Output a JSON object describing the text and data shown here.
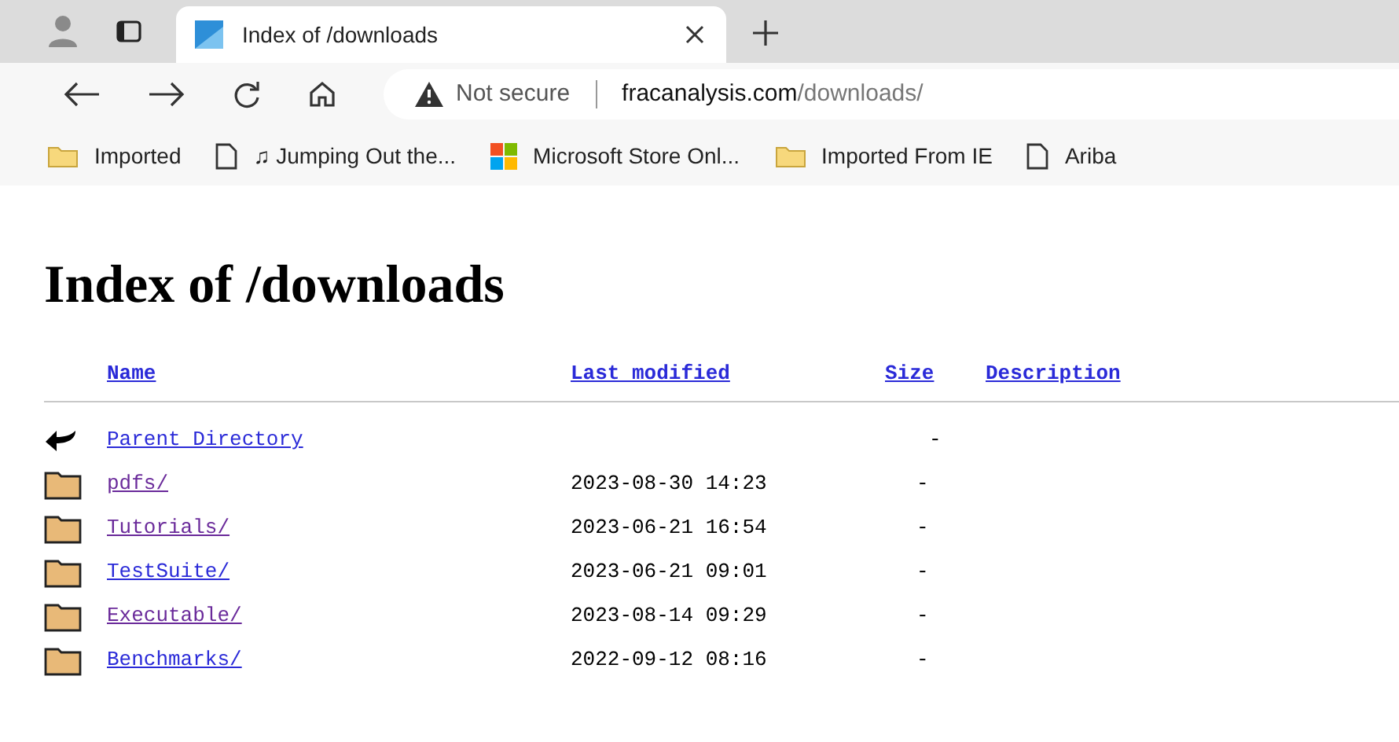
{
  "tab": {
    "title": "Index of /downloads",
    "selected": true
  },
  "address": {
    "warning": "Not secure",
    "host": "fracanalysis.com",
    "path": "/downloads/"
  },
  "bookmarks": [
    {
      "kind": "folder",
      "label": "Imported"
    },
    {
      "kind": "page",
      "label": "♫ Jumping Out the..."
    },
    {
      "kind": "store",
      "label": "Microsoft Store Onl..."
    },
    {
      "kind": "folder",
      "label": "Imported From IE"
    },
    {
      "kind": "page",
      "label": "Ariba"
    }
  ],
  "heading": "Index of /downloads",
  "columns": [
    "Name",
    "Last modified",
    "Size",
    "Description"
  ],
  "rows": [
    {
      "kind": "parent",
      "name": "Parent Directory",
      "visited": false,
      "modified": "",
      "size": "-"
    },
    {
      "kind": "folder",
      "name": "pdfs/",
      "visited": true,
      "modified": "2023-08-30 14:23",
      "size": "-"
    },
    {
      "kind": "folder",
      "name": "Tutorials/",
      "visited": true,
      "modified": "2023-06-21 16:54",
      "size": "-"
    },
    {
      "kind": "folder",
      "name": "TestSuite/",
      "visited": false,
      "modified": "2023-06-21 09:01",
      "size": "-"
    },
    {
      "kind": "folder",
      "name": "Executable/",
      "visited": true,
      "modified": "2023-08-14 09:29",
      "size": "-"
    },
    {
      "kind": "folder",
      "name": "Benchmarks/",
      "visited": false,
      "modified": "2022-09-12 08:16",
      "size": "-"
    }
  ]
}
